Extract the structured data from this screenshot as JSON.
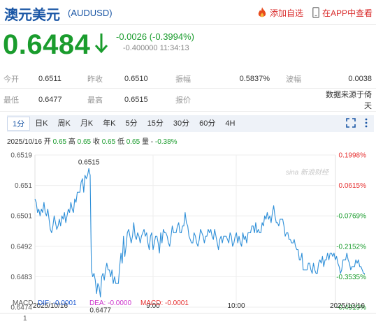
{
  "header": {
    "name": "澳元美元",
    "code": "(AUDUSD)",
    "add_label": "添加自选",
    "app_label": "在APP中查看"
  },
  "quote": {
    "price": "0.6484",
    "change": "-0.0026 (-0.3994%)",
    "sub": "-0.400000 11:34:13"
  },
  "stats": {
    "rows": [
      [
        {
          "label": "今开",
          "value": "0.6511"
        },
        {
          "label": "昨收",
          "value": "0.6510"
        },
        {
          "label": "振幅",
          "value": "0.5837%"
        },
        {
          "label": "波幅",
          "value": "0.0038"
        }
      ],
      [
        {
          "label": "最低",
          "value": "0.6477"
        },
        {
          "label": "最高",
          "value": "0.6515"
        },
        {
          "label": "报价",
          "value": ""
        },
        {
          "label": "",
          "value": "数据来源于倚天"
        }
      ]
    ]
  },
  "tabs": [
    "1分",
    "日K",
    "周K",
    "月K",
    "年K",
    "5分",
    "15分",
    "30分",
    "60分",
    "4H"
  ],
  "active_tab": "1分",
  "info": {
    "date": "2025/10/16",
    "open_label": "开",
    "open": "0.65",
    "high_label": "高",
    "high": "0.65",
    "close_label": "收",
    "close": "0.65",
    "low_label": "低",
    "low": "0.65",
    "vol_label": "量",
    "pct": "-0.38%"
  },
  "macd": {
    "label": "MACD",
    "dif": "DIF: -0.0001",
    "dea": "DEA: -0.0000",
    "macd": "MACD: -0.0001",
    "bottom_value": "1"
  },
  "watermark": "sina 新浪财经",
  "colors": {
    "up": "#e62f2f",
    "down": "#1a9c2d",
    "line": "#2e8fd8",
    "brand": "#1a56a5"
  },
  "chart_data": {
    "type": "line",
    "title": "",
    "xlabel": "",
    "ylabel": "",
    "y_ticks": [
      "0.6519",
      "0.651",
      "0.6501",
      "0.6492",
      "0.6483",
      "0.6474"
    ],
    "pct_ticks": [
      "0.1998%",
      "0.0615%",
      "-0.0769%",
      "-0.2152%",
      "-0.3535%",
      "-0.4919%"
    ],
    "x_ticks": [
      "2025/10/16",
      "9:00",
      "10:00",
      "2025/10/16"
    ],
    "ylim": [
      0.6474,
      0.6519
    ],
    "annotations": [
      {
        "text": "0.6515",
        "value": 0.6515
      },
      {
        "text": "0.6477",
        "value": 0.6477
      }
    ],
    "series": [
      {
        "values": [
          0.6506,
          0.6505,
          0.6502,
          0.6503,
          0.6501,
          0.6503,
          0.6502,
          0.6505,
          0.6502,
          0.6501,
          0.6503,
          0.65,
          0.6497,
          0.6496,
          0.6498,
          0.6501,
          0.6499,
          0.6497,
          0.6498,
          0.65,
          0.6498,
          0.6501,
          0.65,
          0.6502,
          0.6499,
          0.6501,
          0.6503,
          0.6502,
          0.6505,
          0.6503,
          0.6502,
          0.6506,
          0.6505,
          0.6508,
          0.6508,
          0.6508,
          0.6511,
          0.6512,
          0.6508,
          0.6513,
          0.6512,
          0.6513,
          0.6515,
          0.6513,
          0.6485,
          0.6483,
          0.6484,
          0.6482,
          0.6478,
          0.6481,
          0.648,
          0.6477,
          0.6483,
          0.6484,
          0.6482,
          0.6485,
          0.6487,
          0.6485,
          0.6485,
          0.6483,
          0.6485,
          0.6481,
          0.6483,
          0.6481,
          0.6481,
          0.6481,
          0.6486,
          0.649,
          0.6487,
          0.6495,
          0.6489,
          0.6492,
          0.6496,
          0.6497,
          0.6495,
          0.6493,
          0.6495,
          0.6499,
          0.6495,
          0.6494,
          0.6496,
          0.6495,
          0.6493,
          0.6495,
          0.6496,
          0.6497,
          0.6495,
          0.6496,
          0.6493,
          0.6491,
          0.6495,
          0.6496,
          0.6491,
          0.6493,
          0.6495,
          0.6495,
          0.6493,
          0.649,
          0.6496,
          0.6493,
          0.6497,
          0.6496,
          0.6496,
          0.6495,
          0.6493,
          0.6492,
          0.6495,
          0.6498,
          0.6496,
          0.6496,
          0.6496,
          0.6498,
          0.6499,
          0.6496,
          0.6496,
          0.6498,
          0.6498,
          0.6502,
          0.6499,
          0.6498,
          0.6495,
          0.6494,
          0.6493,
          0.6493,
          0.6496,
          0.6495,
          0.6493,
          0.6492,
          0.6494,
          0.6497,
          0.6496,
          0.6495,
          0.6493,
          0.6495,
          0.6495,
          0.6497,
          0.6496,
          0.6497,
          0.6495,
          0.6494,
          0.6497,
          0.6495,
          0.6493,
          0.6491,
          0.6494,
          0.6495,
          0.6493,
          0.6495,
          0.6495,
          0.6495,
          0.6494,
          0.6493,
          0.6496,
          0.6495,
          0.6492,
          0.6493,
          0.6495,
          0.6496,
          0.6493,
          0.6495,
          0.6493,
          0.6492,
          0.6496,
          0.6494,
          0.6495,
          0.6493,
          0.6496,
          0.6496,
          0.6496,
          0.6498,
          0.6498,
          0.6496,
          0.6499,
          0.6496,
          0.6497,
          0.6496,
          0.6496,
          0.6499,
          0.6498,
          0.6501,
          0.65,
          0.6502,
          0.65,
          0.6501,
          0.6499,
          0.6502,
          0.6504,
          0.6501,
          0.6499,
          0.6499,
          0.6498,
          0.65,
          0.65,
          0.65,
          0.6498,
          0.6495,
          0.6496,
          0.6496,
          0.6494,
          0.6494,
          0.6493,
          0.6493,
          0.6494,
          0.6492,
          0.6491,
          0.6491,
          0.6488,
          0.6488,
          0.649,
          0.6485,
          0.6485,
          0.6485,
          0.6485,
          0.6487,
          0.6487,
          0.6485,
          0.6484,
          0.6487,
          0.6485,
          0.6484,
          0.6484,
          0.6487,
          0.6488,
          0.6487,
          0.6489,
          0.6486,
          0.6488,
          0.6488,
          0.649,
          0.6488,
          0.649,
          0.649,
          0.6489,
          0.649,
          0.6488,
          0.6489,
          0.6487,
          0.6486,
          0.6484,
          0.6485,
          0.6488,
          0.6488,
          0.6488,
          0.649,
          0.6488,
          0.6487,
          0.6485,
          0.6486,
          0.6486,
          0.6486,
          0.6488,
          0.6487,
          0.6488,
          0.6486,
          0.6486,
          0.6485,
          0.6484,
          0.6484
        ]
      }
    ]
  }
}
